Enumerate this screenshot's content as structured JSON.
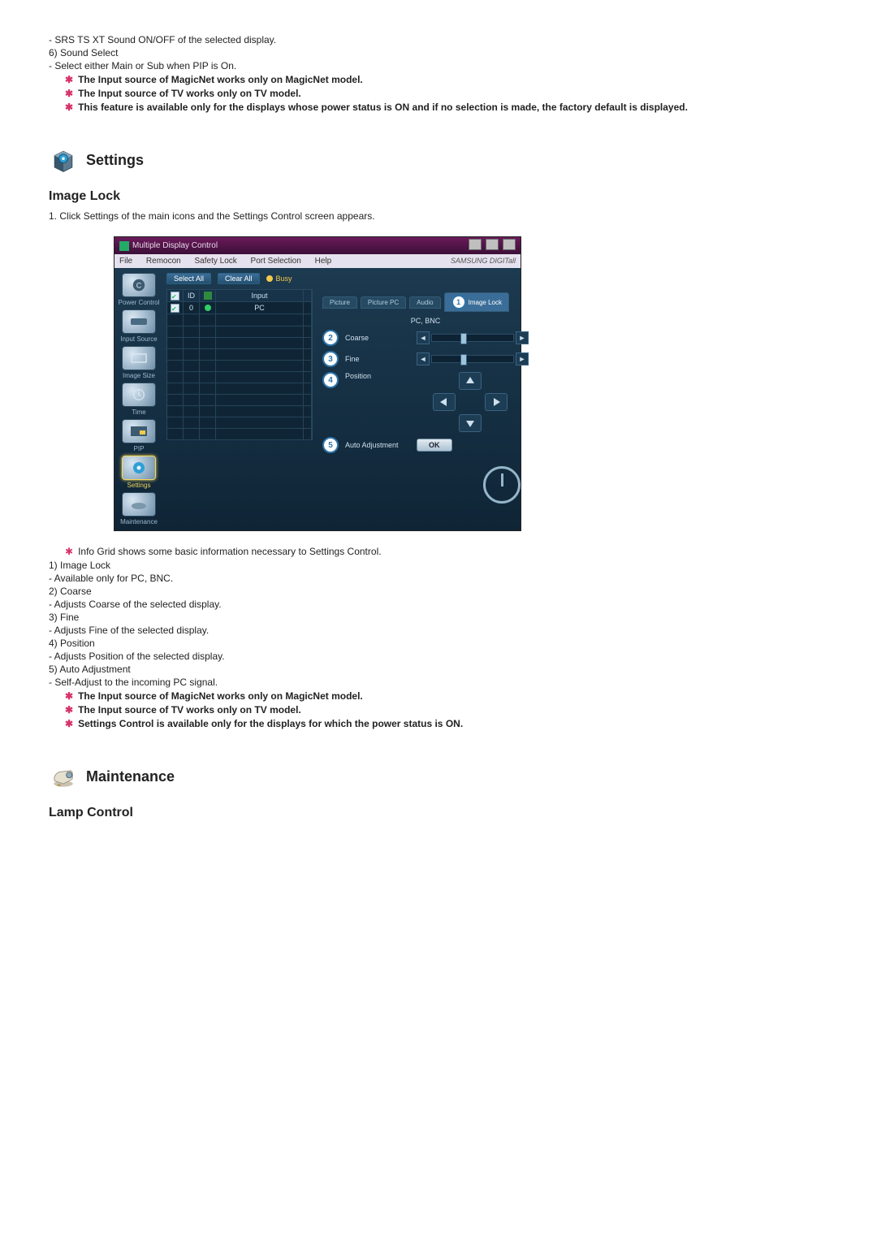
{
  "intro": {
    "srs_bullet": "- SRS TS XT Sound ON/OFF of the selected display.",
    "item6_num": "6)",
    "item6_label": "Sound Select",
    "item6_desc": "- Select either Main or Sub when PIP is On.",
    "star1": "The Input source of MagicNet works only on MagicNet model.",
    "star2": "The Input source of TV works only on TV model.",
    "star3": "This feature is available only for the displays whose power status is ON and if no selection is made, the factory default is displayed."
  },
  "settings": {
    "heading": "Settings",
    "subhead": "Image Lock",
    "step1_num": "1.",
    "step1_text": "Click Settings of the main icons and the Settings Control screen appears."
  },
  "mdc": {
    "title": "Multiple Display Control",
    "menus": [
      "File",
      "Remocon",
      "Safety Lock",
      "Port Selection",
      "Help"
    ],
    "brand": "SAMSUNG DIGITall",
    "buttons": {
      "select_all": "Select All",
      "clear_all": "Clear All"
    },
    "busy": "Busy",
    "sidebar": [
      "Power Control",
      "Input Source",
      "Image Size",
      "Time",
      "PIP",
      "Settings",
      "Maintenance"
    ],
    "grid": {
      "headers": [
        "",
        "ID",
        "",
        "Input"
      ],
      "row": {
        "id": "0",
        "input": "PC"
      }
    },
    "tabs": {
      "picture": "Picture",
      "picture_pc": "Picture PC",
      "audio": "Audio",
      "image_lock": "Image Lock"
    },
    "panel_label": "PC, BNC",
    "controls": {
      "coarse": "Coarse",
      "fine": "Fine",
      "position": "Position",
      "auto_adj": "Auto Adjustment",
      "ok": "OK"
    },
    "callouts": {
      "n1": "1",
      "n2": "2",
      "n3": "3",
      "n4": "4",
      "n5": "5"
    }
  },
  "after": {
    "star_info": "Info Grid shows some basic information necessary to Settings Control.",
    "items": [
      {
        "num": "1)",
        "label": "Image Lock",
        "desc": "- Available only for PC, BNC."
      },
      {
        "num": "2)",
        "label": "Coarse",
        "desc": "- Adjusts Coarse of the selected display."
      },
      {
        "num": "3)",
        "label": "Fine",
        "desc": "- Adjusts Fine of the selected display."
      },
      {
        "num": "4)",
        "label": "Position",
        "desc": "- Adjusts Position of the selected display."
      },
      {
        "num": "5)",
        "label": "Auto Adjustment",
        "desc": "- Self-Adjust to the incoming PC signal."
      }
    ],
    "star1": "The Input source of MagicNet works only on MagicNet model.",
    "star2": "The Input source of TV works only on TV model.",
    "star3": "Settings Control is available only for the displays for which the power status is ON."
  },
  "maintenance": {
    "heading": "Maintenance",
    "subhead": "Lamp Control"
  }
}
